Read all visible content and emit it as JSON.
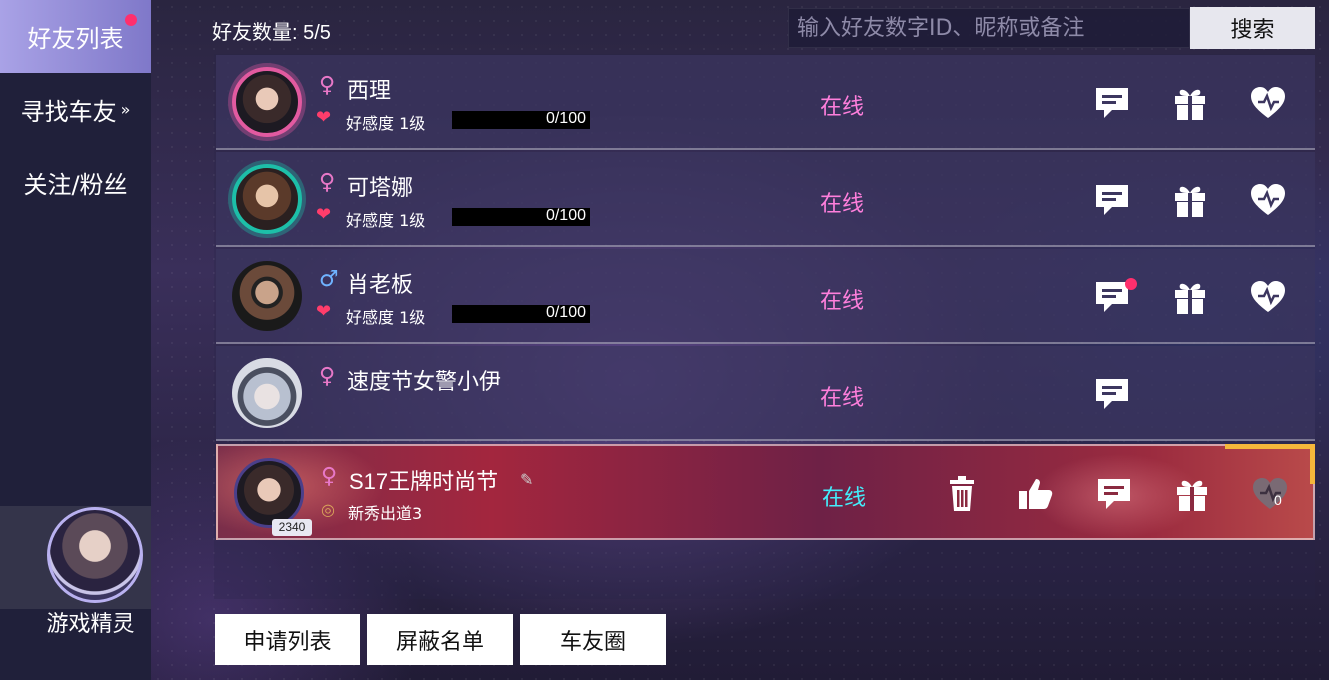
{
  "sidebar": {
    "items": [
      {
        "label": "好友列表",
        "active": true,
        "has_notification": true
      },
      {
        "label": "寻找车友",
        "chevron": "»"
      },
      {
        "label": "关注/粉丝"
      }
    ],
    "genie_label": "游戏精灵"
  },
  "header": {
    "friend_count": "好友数量: 5/5",
    "search_placeholder": "输入好友数字ID、昵称或备注",
    "search_button": "搜索"
  },
  "friends": [
    {
      "gender_symbol": "♀",
      "gender": "female",
      "name": "西理",
      "favor_label": "好感度 1级",
      "favor_value": "0/100",
      "favor_progress": 0,
      "status": "在线",
      "actions": [
        "message-icon",
        "gift-icon",
        "heart-icon"
      ]
    },
    {
      "gender_symbol": "♀",
      "gender": "female",
      "name": "可塔娜",
      "favor_label": "好感度 1级",
      "favor_value": "0/100",
      "favor_progress": 0,
      "status": "在线",
      "actions": [
        "message-icon",
        "gift-icon",
        "heart-icon"
      ]
    },
    {
      "gender_symbol": "♂",
      "gender": "male",
      "name": "肖老板",
      "favor_label": "好感度 1级",
      "favor_value": "0/100",
      "favor_progress": 0,
      "status": "在线",
      "message_notification": true,
      "actions": [
        "message-icon",
        "gift-icon",
        "heart-icon"
      ]
    },
    {
      "gender_symbol": "♀",
      "gender": "female",
      "name": "速度节女警小伊",
      "status": "在线",
      "actions": [
        "message-icon"
      ]
    },
    {
      "gender_symbol": "♀",
      "gender": "female",
      "name": "S17王牌时尚节",
      "level_badge": "2340",
      "rank_label": "新秀出道3",
      "status": "在线",
      "heart_count": "0",
      "actions": [
        "trash-icon",
        "thumbs-up-icon",
        "message-icon",
        "gift-icon",
        "heart-icon"
      ]
    }
  ],
  "footer": {
    "apply_list": "申请列表",
    "block_list": "屏蔽名单",
    "car_circle": "车友圈"
  },
  "colors": {
    "status_online_pink": "#ff7fdc",
    "status_online_cyan": "#43eefc",
    "notification_dot": "#ff2f6d",
    "sidebar_active": "#a9a2e6",
    "sidebar_bg": "#20203a"
  }
}
